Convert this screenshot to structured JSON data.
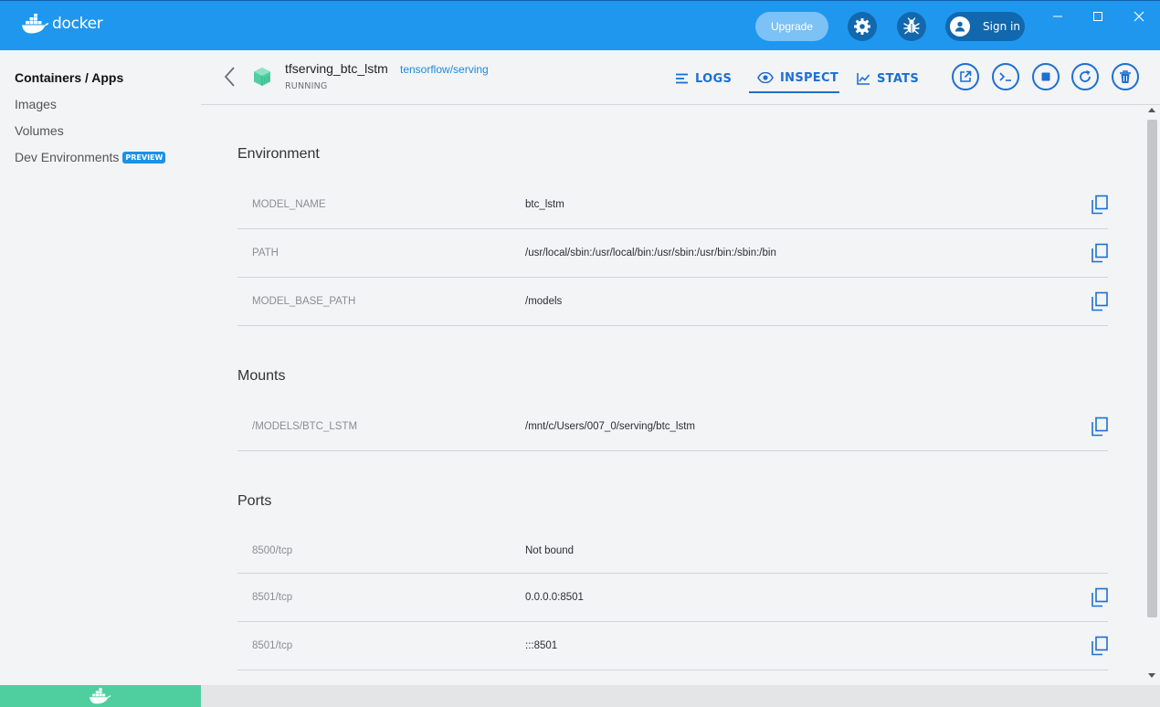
{
  "app": {
    "name": "docker"
  },
  "topbar": {
    "upgrade_label": "Upgrade",
    "signin_label": "Sign in"
  },
  "sidebar": {
    "items": [
      {
        "label": "Containers / Apps",
        "active": true
      },
      {
        "label": "Images"
      },
      {
        "label": "Volumes"
      },
      {
        "label": "Dev Environments",
        "badge": "PREVIEW"
      }
    ]
  },
  "container": {
    "name": "tfserving_btc_lstm",
    "image": "tensorflow/serving",
    "status": "RUNNING"
  },
  "tabs": [
    {
      "label": "LOGS",
      "icon": "logs-icon"
    },
    {
      "label": "INSPECT",
      "icon": "eye-icon",
      "active": true
    },
    {
      "label": "STATS",
      "icon": "chart-icon"
    }
  ],
  "actions": [
    "open-browser-icon",
    "cli-icon",
    "stop-icon",
    "restart-icon",
    "delete-icon"
  ],
  "sections": {
    "environment": {
      "title": "Environment",
      "rows": [
        {
          "key": "MODEL_NAME",
          "value": "btc_lstm"
        },
        {
          "key": "PATH",
          "value": "/usr/local/sbin:/usr/local/bin:/usr/sbin:/usr/bin:/sbin:/bin"
        },
        {
          "key": "MODEL_BASE_PATH",
          "value": "/models"
        }
      ]
    },
    "mounts": {
      "title": "Mounts",
      "rows": [
        {
          "key": "/MODELS/BTC_LSTM",
          "value": "/mnt/c/Users/007_0/serving/btc_lstm"
        }
      ]
    },
    "ports": {
      "title": "Ports",
      "rows": [
        {
          "key": "8500/tcp",
          "value": "Not bound"
        },
        {
          "key": "8501/tcp",
          "value": "0.0.0.0:8501"
        },
        {
          "key": "8501/tcp",
          "value": ":::8501"
        }
      ]
    }
  },
  "colors": {
    "brand": "#1f97ee",
    "accent": "#1d6fd1",
    "running": "#4fcfa0"
  }
}
